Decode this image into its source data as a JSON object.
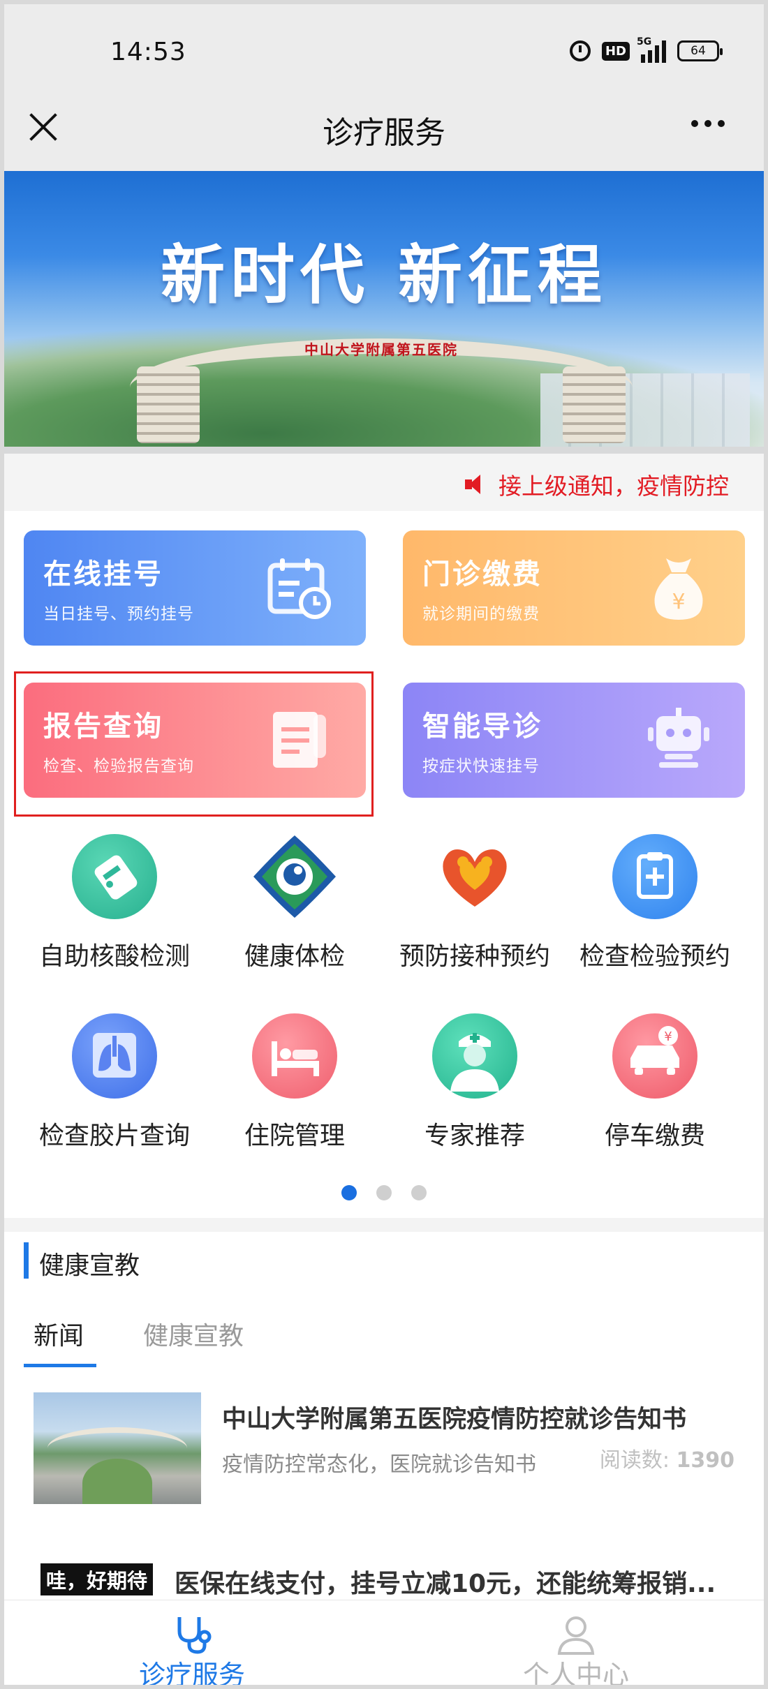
{
  "status_bar": {
    "time": "14:53",
    "network": "5G",
    "hd_badge": "HD",
    "battery": "64"
  },
  "nav": {
    "title": "诊疗服务"
  },
  "banner": {
    "headline": "新时代  新征程",
    "gate_sign": "中山大学附属第五医院"
  },
  "notice": {
    "text": "接上级通知，疫情防控"
  },
  "cards": [
    {
      "title": "在线挂号",
      "subtitle": "当日挂号、预约挂号",
      "icon": "calendar-clock-icon"
    },
    {
      "title": "门诊缴费",
      "subtitle": "就诊期间的缴费",
      "icon": "money-bag-icon"
    },
    {
      "title": "报告查询",
      "subtitle": "检查、检验报告查询",
      "icon": "report-scroll-icon"
    },
    {
      "title": "智能导诊",
      "subtitle": "按症状快速挂号",
      "icon": "robot-icon"
    }
  ],
  "grid": [
    {
      "label": "自助核酸检测",
      "icon": "test-tube-icon",
      "color": "#2fb89a"
    },
    {
      "label": "健康体检",
      "icon": "health-check-icon",
      "color": "#1d5aa8"
    },
    {
      "label": "预防接种预约",
      "icon": "heart-hands-icon",
      "color": "#e8542c"
    },
    {
      "label": "检查检验预约",
      "icon": "clipboard-plus-icon",
      "color": "#3c8ff2"
    },
    {
      "label": "检查胶片查询",
      "icon": "lungs-icon",
      "color": "#4c7ef0"
    },
    {
      "label": "住院管理",
      "icon": "hospital-bed-icon",
      "color": "#f2727f"
    },
    {
      "label": "专家推荐",
      "icon": "doctor-icon",
      "color": "#2ec49c"
    },
    {
      "label": "停车缴费",
      "icon": "car-yen-icon",
      "color": "#f16a78"
    }
  ],
  "pager": {
    "count": 3,
    "active": 0
  },
  "health_section": {
    "title": "健康宣教",
    "tabs": [
      {
        "label": "新闻",
        "active": true
      },
      {
        "label": "健康宣教",
        "active": false
      }
    ],
    "articles": [
      {
        "title": "中山大学附属第五医院疫情防控就诊告知书",
        "summary": "疫情防控常态化，医院就诊告知书",
        "read_label": "阅读数:",
        "read_count": "1390"
      }
    ],
    "promo": {
      "tag": "哇，好期待",
      "title": "医保在线支付，挂号立减10元，还能统筹报销..."
    }
  },
  "bottom_nav": [
    {
      "label": "诊疗服务",
      "icon": "stethoscope-icon",
      "active": true
    },
    {
      "label": "个人中心",
      "icon": "person-icon",
      "active": false
    }
  ],
  "colors": {
    "accent": "#1e79e6",
    "notice_red": "#e21b23",
    "highlight_red": "#e0201f"
  }
}
